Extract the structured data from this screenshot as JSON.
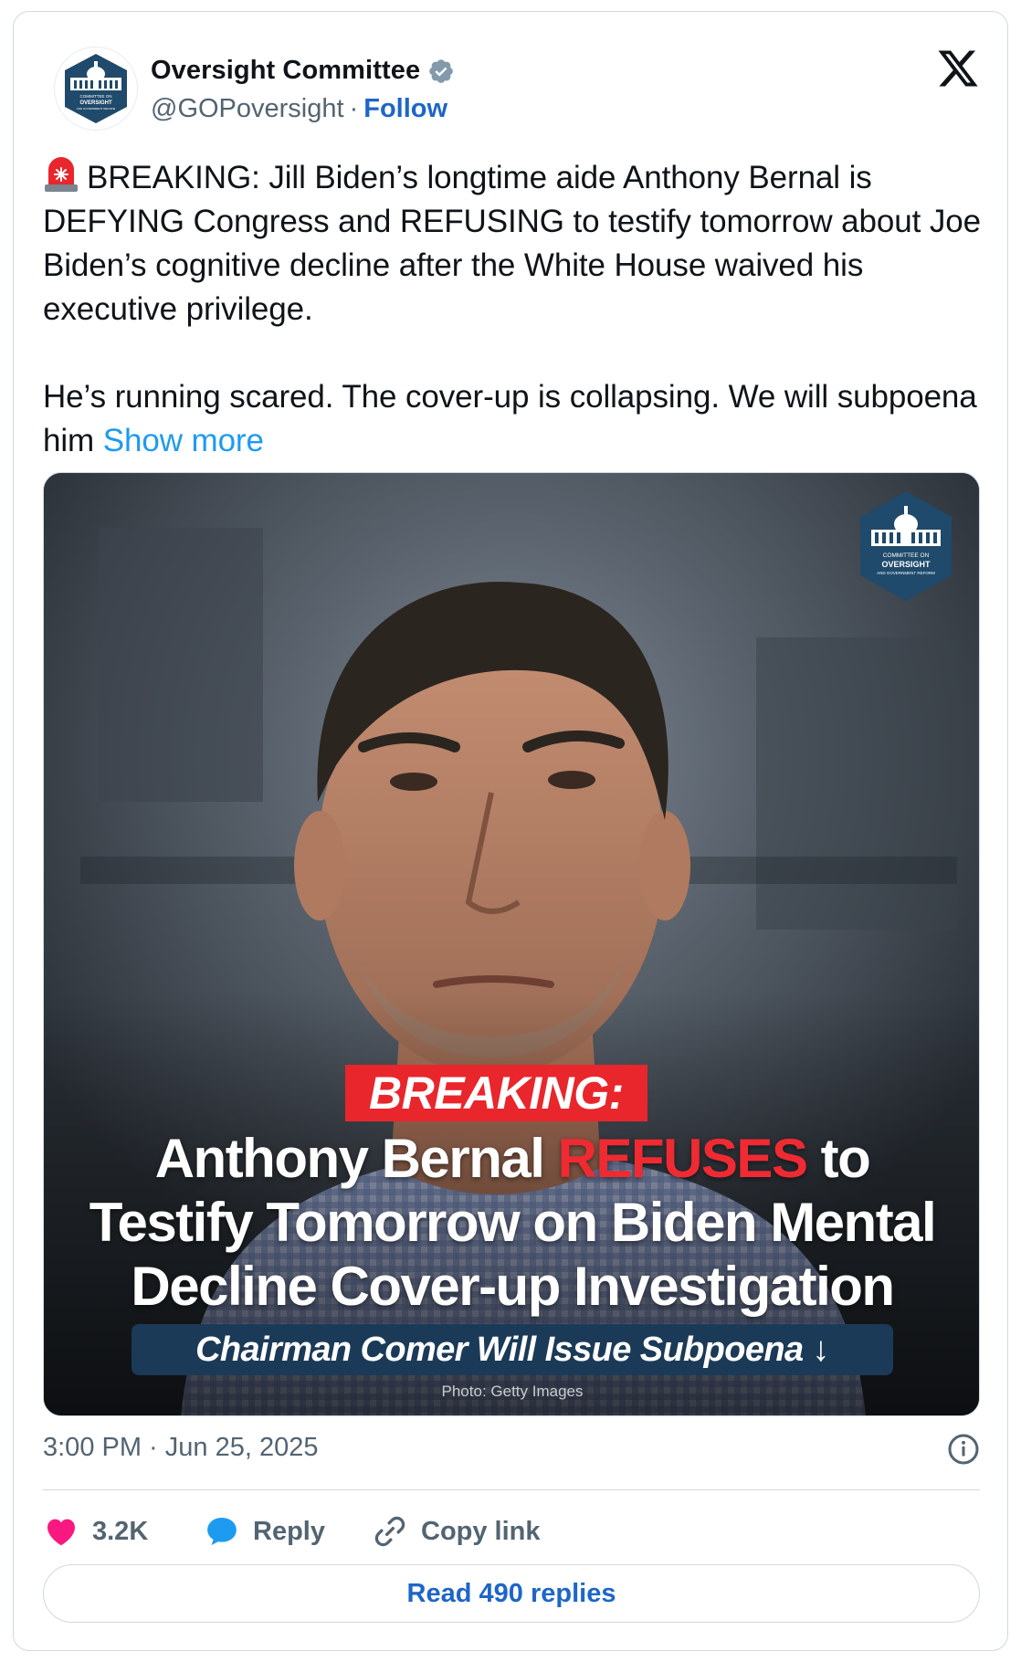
{
  "author": {
    "name": "Oversight Committee",
    "handle": "@GOPoversight",
    "separator": "·",
    "follow_label": "Follow",
    "avatar_icon": "capitol-logo-icon",
    "avatar_text": [
      "COMMITTEE ON",
      "OVERSIGHT",
      "AND GOVERNMENT REFORM"
    ]
  },
  "tweet": {
    "paragraph1": "BREAKING: Jill Biden’s longtime aide Anthony Bernal is DEFYING Congress and REFUSING to testify tomorrow about Joe Biden’s cognitive decline after the White House waived his executive privilege.",
    "paragraph2_text": "He’s running scared. The cover-up is collapsing. We will subpoena him",
    "show_more": "Show more",
    "emoji": "siren-icon"
  },
  "media": {
    "tag": "BREAKING:",
    "headline_part1": "Anthony Bernal ",
    "headline_red": "REFUSES",
    "headline_part2": " to",
    "headline_line2": "Testify Tomorrow on Biden Mental",
    "headline_line3": "Decline Cover-up Investigation",
    "subpoena": "Chairman Comer Will Issue Subpoena ↓",
    "credit": "Photo: Getty Images",
    "logo_lines": [
      "COMMITTEE ON",
      "OVERSIGHT",
      "AND GOVERNMENT REFORM"
    ]
  },
  "meta": {
    "timestamp": "3:00 PM · Jun 25, 2025"
  },
  "actions": {
    "likes": "3.2K",
    "reply": "Reply",
    "copy_link": "Copy link",
    "read_replies": "Read 490 replies"
  },
  "colors": {
    "link": "#1d9bf0",
    "follow": "#1d66c8",
    "like": "#f91880",
    "breaking_red": "#e8262c",
    "navy": "#1b3a57"
  }
}
